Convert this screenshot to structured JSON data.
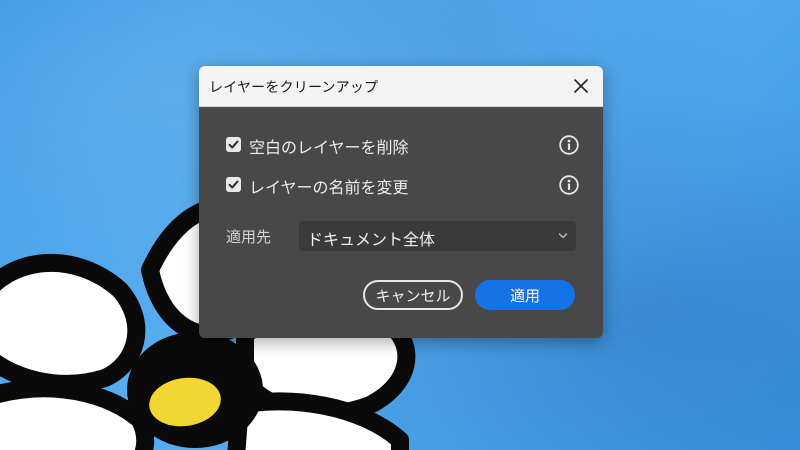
{
  "dialog": {
    "title": "レイヤーをクリーンアップ",
    "options": [
      {
        "label": "空白のレイヤーを削除",
        "checked": true
      },
      {
        "label": "レイヤーの名前を変更",
        "checked": true
      }
    ],
    "apply_to": {
      "label": "適用先",
      "selected": "ドキュメント全体"
    },
    "buttons": {
      "cancel": "キャンセル",
      "apply": "適用"
    }
  },
  "icons": {
    "close": "close-icon",
    "info": "info-icon",
    "checkmark": "checkmark-icon",
    "dropdown": "chevron-down-icon"
  },
  "colors": {
    "accent": "#1473e6",
    "dialog_bg": "#484848",
    "titlebar_bg": "#f3f3f3",
    "canvas_bg": "#4aa3e6",
    "flower_center": "#f2d631"
  }
}
